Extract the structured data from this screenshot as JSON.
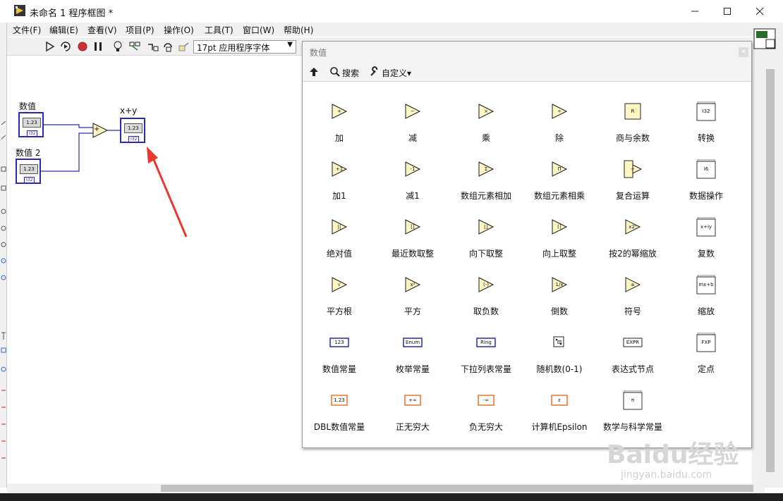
{
  "window": {
    "title": "未命名 1 程序框图 *"
  },
  "menu": [
    "文件(F)",
    "编辑(E)",
    "查看(V)",
    "项目(P)",
    "操作(O)",
    "工具(T)",
    "窗口(W)",
    "帮助(H)"
  ],
  "toolbar": {
    "font_select": "17pt 应用程序字体"
  },
  "diagram": {
    "control1_label": "数值",
    "control2_label": "数值 2",
    "indicator_label": "x+y",
    "numeric_display": "1.23",
    "type_tag": "I32",
    "add_glyph": "+"
  },
  "palette": {
    "title": "数值",
    "search_label": "搜索",
    "customize_label": "自定义▾",
    "items": [
      {
        "label": "加",
        "icon": "add-icon",
        "glyph": "+"
      },
      {
        "label": "减",
        "icon": "subtract-icon",
        "glyph": "−"
      },
      {
        "label": "乘",
        "icon": "multiply-icon",
        "glyph": "×"
      },
      {
        "label": "除",
        "icon": "divide-icon",
        "glyph": "÷"
      },
      {
        "label": "商与余数",
        "icon": "quotient-remainder-icon",
        "glyph": "R"
      },
      {
        "label": "转换",
        "icon": "conversion-folder-icon",
        "glyph": "I32"
      },
      {
        "label": "加1",
        "icon": "increment-icon",
        "glyph": "+1"
      },
      {
        "label": "减1",
        "icon": "decrement-icon",
        "glyph": "-1"
      },
      {
        "label": "数组元素相加",
        "icon": "add-array-elements-icon",
        "glyph": "Σ"
      },
      {
        "label": "数组元素相乘",
        "icon": "multiply-array-elements-icon",
        "glyph": "Π"
      },
      {
        "label": "复合运算",
        "icon": "compound-arithmetic-icon",
        "glyph": "+"
      },
      {
        "label": "数据操作",
        "icon": "data-manipulation-folder-icon",
        "glyph": "I6"
      },
      {
        "label": "绝对值",
        "icon": "absolute-value-icon",
        "glyph": "||"
      },
      {
        "label": "最近数取整",
        "icon": "round-nearest-icon",
        "glyph": "[]"
      },
      {
        "label": "向下取整",
        "icon": "round-down-icon",
        "glyph": "⌊⌋"
      },
      {
        "label": "向上取整",
        "icon": "round-up-icon",
        "glyph": "⌈⌉"
      },
      {
        "label": "按2的幂缩放",
        "icon": "scale-by-power-of-2-icon",
        "glyph": "x2ⁿ"
      },
      {
        "label": "复数",
        "icon": "complex-folder-icon",
        "glyph": "x+iy"
      },
      {
        "label": "平方根",
        "icon": "square-root-icon",
        "glyph": "√"
      },
      {
        "label": "平方",
        "icon": "square-icon",
        "glyph": "x²"
      },
      {
        "label": "取负数",
        "icon": "negate-icon",
        "glyph": "(-)"
      },
      {
        "label": "倒数",
        "icon": "reciprocal-icon",
        "glyph": "1/x"
      },
      {
        "label": "符号",
        "icon": "sign-icon",
        "glyph": "±"
      },
      {
        "label": "缩放",
        "icon": "scaling-folder-icon",
        "glyph": "mx+b"
      },
      {
        "label": "数值常量",
        "icon": "numeric-constant-icon",
        "glyph": "123"
      },
      {
        "label": "枚举常量",
        "icon": "enum-constant-icon",
        "glyph": "Enum"
      },
      {
        "label": "下拉列表常量",
        "icon": "ring-constant-icon",
        "glyph": "Ring"
      },
      {
        "label": "随机数(0-1)",
        "icon": "random-number-icon",
        "glyph": "⚄"
      },
      {
        "label": "表达式节点",
        "icon": "expression-node-icon",
        "glyph": "EXPR"
      },
      {
        "label": "定点",
        "icon": "fixed-point-folder-icon",
        "glyph": "FXP"
      },
      {
        "label": "DBL数值常量",
        "icon": "dbl-numeric-constant-icon",
        "glyph": "1.23"
      },
      {
        "label": "正无穷大",
        "icon": "positive-infinity-icon",
        "glyph": "+∞"
      },
      {
        "label": "负无穷大",
        "icon": "negative-infinity-icon",
        "glyph": "-∞"
      },
      {
        "label": "计算机Epsilon",
        "icon": "machine-epsilon-icon",
        "glyph": "ε"
      },
      {
        "label": "数学与科学常量",
        "icon": "math-science-constants-folder-icon",
        "glyph": "π"
      }
    ]
  },
  "watermark": {
    "text": "Baidu经验",
    "url": "jingyan.baidu.com"
  },
  "colors": {
    "wire": "#2a2aa8",
    "function_fill": "#fdf5c4",
    "arrow": "#e8392f",
    "orange_constant": "#e8752f"
  }
}
